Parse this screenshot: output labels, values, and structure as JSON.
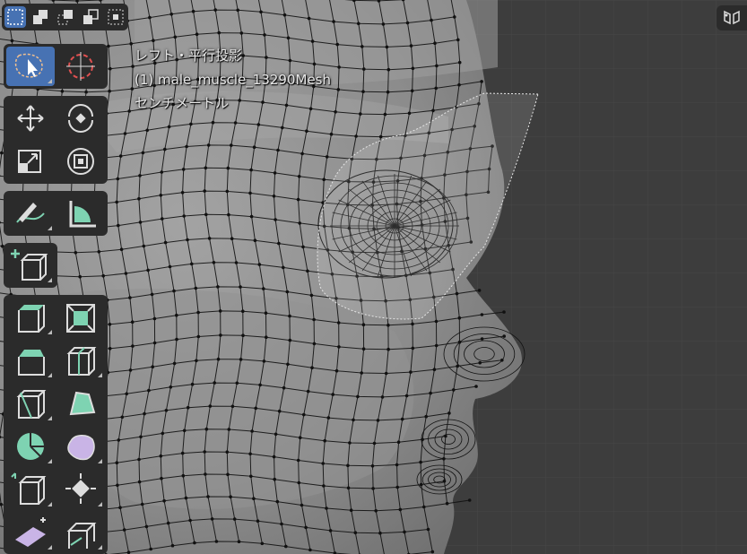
{
  "viewport": {
    "view_name": "レフト・平行投影",
    "object_info": "(1) male_muscle_13290Mesh",
    "units": "センチメートル"
  },
  "colors": {
    "background": "#3d3d3d",
    "grid": "#4a4a4a",
    "mesh_surface": "#8a8a8a",
    "wire": "#111111",
    "toolbar_bg": "#2b2b2b",
    "active_tool": "#4772b3",
    "add_tool_accent": "#7ed3b2",
    "deform_tool_accent": "#c9b4e6"
  },
  "mode_bar": {
    "buttons": [
      "select-new-icon",
      "select-extend-icon",
      "select-subtract-icon",
      "select-invert-icon",
      "select-intersect-icon"
    ],
    "active_index": 0
  },
  "toolbar": {
    "tools": [
      "select-box-tool",
      "cursor-tool",
      "move-tool",
      "rotate-tool",
      "scale-tool",
      "transform-tool",
      "annotate-tool",
      "measure-tool",
      "add-cube-tool",
      "extrude-region-tool",
      "inset-faces-tool",
      "bevel-tool",
      "loop-cut-tool",
      "knife-tool",
      "poly-build-tool",
      "spin-tool",
      "smooth-vertices-tool",
      "edge-slide-tool",
      "shrink-fatten-tool",
      "shear-tool",
      "rip-region-tool"
    ],
    "active_tool": "select-box-tool"
  },
  "navigation_gizmo": {
    "icon": "view-toggle-icon"
  }
}
